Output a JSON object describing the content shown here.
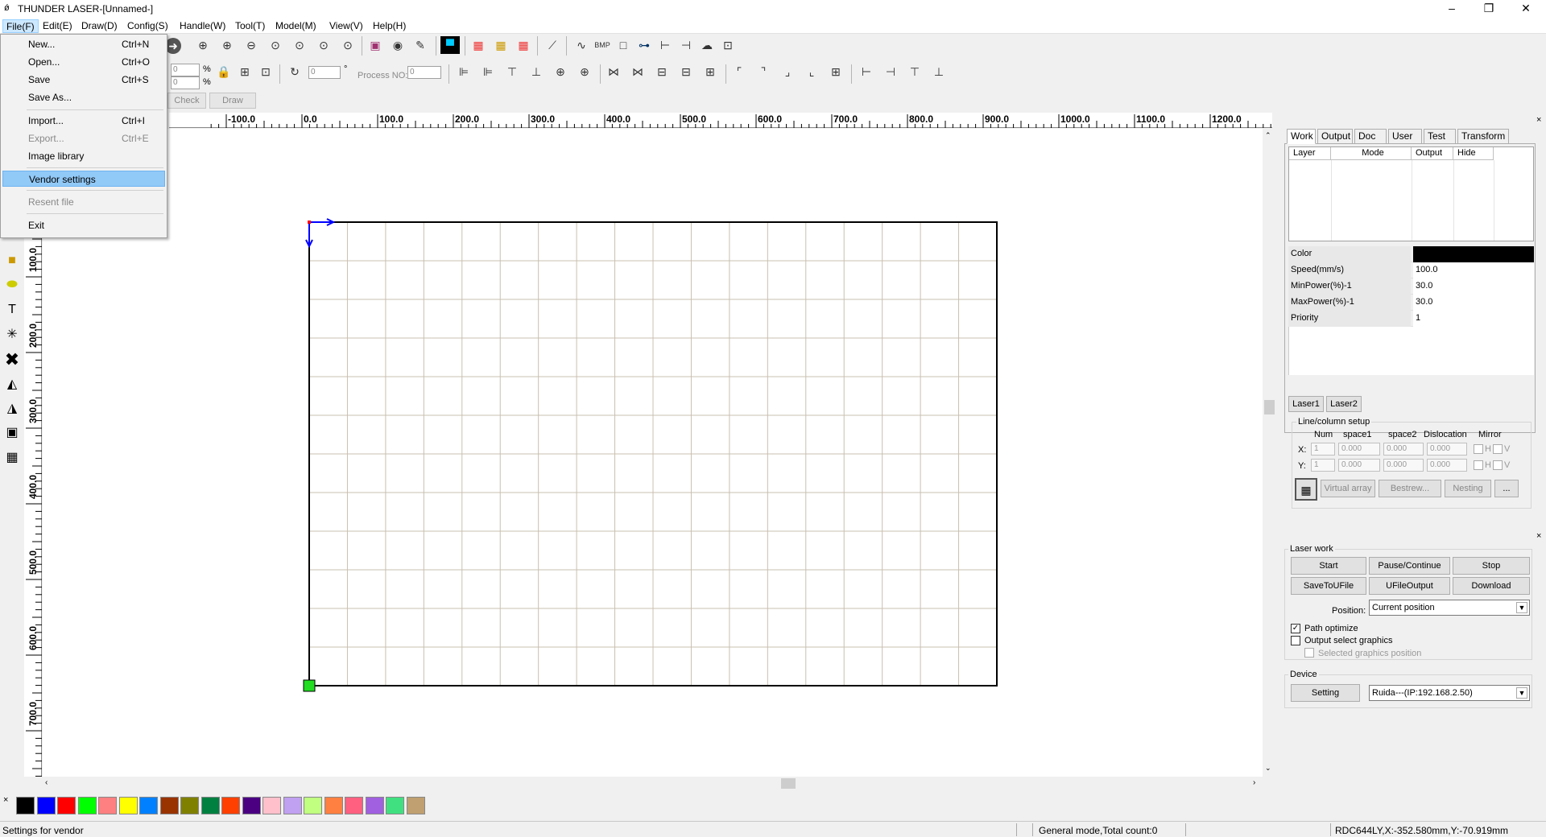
{
  "window": {
    "title": "THUNDER LASER-[Unnamed-]",
    "minimize": "–",
    "maximize": "❐",
    "close": "✕"
  },
  "menus": [
    "File(F)",
    "Edit(E)",
    "Draw(D)",
    "Config(S)",
    "Handle(W)",
    "Tool(T)",
    "Model(M)",
    "View(V)",
    "Help(H)"
  ],
  "file_menu": {
    "items": [
      {
        "label": "New...",
        "shortcut": "Ctrl+N",
        "enabled": true
      },
      {
        "label": "Open...",
        "shortcut": "Ctrl+O",
        "enabled": true
      },
      {
        "label": "Save",
        "shortcut": "Ctrl+S",
        "enabled": true
      },
      {
        "label": "Save As...",
        "shortcut": "",
        "enabled": true
      },
      {
        "label": "Import...",
        "shortcut": "Ctrl+I",
        "enabled": true
      },
      {
        "label": "Export...",
        "shortcut": "Ctrl+E",
        "enabled": false
      },
      {
        "label": "Image library",
        "shortcut": "",
        "enabled": true
      },
      {
        "label": "Vendor settings",
        "shortcut": "",
        "enabled": true,
        "highlighted": true
      },
      {
        "label": "Resent file",
        "shortcut": "",
        "enabled": false
      },
      {
        "label": "Exit",
        "shortcut": "",
        "enabled": true
      }
    ]
  },
  "toolbar": {
    "pct1": "0",
    "pct2": "0",
    "pct_unit1": "%",
    "pct_unit2": "%",
    "rotate_value": "0",
    "rotate_unit": "°",
    "process_no_label": "Process NO:",
    "process_no_value": "0",
    "check_label": "Check",
    "draw_label": "Draw",
    "bmp_label": "BMP"
  },
  "ruler_top": [
    "-100.0",
    "0.0",
    "100.0",
    "200.0",
    "300.0",
    "400.0",
    "500.0",
    "600.0",
    "700.0",
    "800.0",
    "900.0",
    "1000.0",
    "1100.0",
    "1200.0"
  ],
  "ruler_left": [
    "100.0",
    "200.0",
    "300.0",
    "400.0",
    "500.0",
    "600.0",
    "700.0"
  ],
  "palette": [
    "#000000",
    "#0000ff",
    "#ff0000",
    "#00ff00",
    "#ff8080",
    "#ffff00",
    "#0080ff",
    "#993300",
    "#808000",
    "#008040",
    "#ff4000",
    "#4b0082",
    "#ffc0cb",
    "#c0a0f0",
    "#c0ff80",
    "#ff8040",
    "#ff6080",
    "#a060e0",
    "#40e080",
    "#c0a070"
  ],
  "palette_close": "×",
  "status": {
    "left": "Settings for vendor",
    "mode": "General mode,Total count:0",
    "coords": "RDC644LY,X:-352.580mm,Y:-70.919mm"
  },
  "right_panel": {
    "close": "×",
    "tabs": [
      "Work",
      "Output",
      "Doc",
      "User",
      "Test",
      "Transform"
    ],
    "layer_headers": [
      "Layer",
      "Mode",
      "Output",
      "Hide"
    ],
    "props": [
      {
        "k": "Color",
        "v": ""
      },
      {
        "k": "Speed(mm/s)",
        "v": "100.0"
      },
      {
        "k": "MinPower(%)-1",
        "v": "30.0"
      },
      {
        "k": "MaxPower(%)-1",
        "v": "30.0"
      },
      {
        "k": "Priority",
        "v": "1"
      }
    ],
    "color_value": "#000000",
    "laser_tabs": [
      "Laser1",
      "Laser2"
    ],
    "array": {
      "title": "Line/column setup",
      "headers": [
        "Num",
        "space1",
        "space2",
        "Dislocation",
        "Mirror"
      ],
      "x_label": "X:",
      "y_label": "Y:",
      "x_vals": [
        "1",
        "0.000",
        "0.000",
        "0.000"
      ],
      "y_vals": [
        "1",
        "0.000",
        "0.000",
        "0.000"
      ],
      "h": "H",
      "v": "V",
      "buttons": [
        "Virtual array",
        "Bestrew...",
        "Nesting",
        "..."
      ]
    },
    "laser_work": {
      "close": "×",
      "title": "Laser work",
      "start": "Start",
      "pause": "Pause/Continue",
      "stop": "Stop",
      "save_u": "SaveToUFile",
      "ufile_out": "UFileOutput",
      "download": "Download",
      "position_label": "Position:",
      "position_value": "Current position",
      "path_optimize": "Path optimize",
      "path_optimize_checked": true,
      "output_select": "Output select graphics",
      "output_select_checked": false,
      "selected_pos": "Selected graphics position"
    },
    "device": {
      "title": "Device",
      "setting": "Setting",
      "device_value": "Ruida---(IP:192.168.2.50)"
    }
  }
}
